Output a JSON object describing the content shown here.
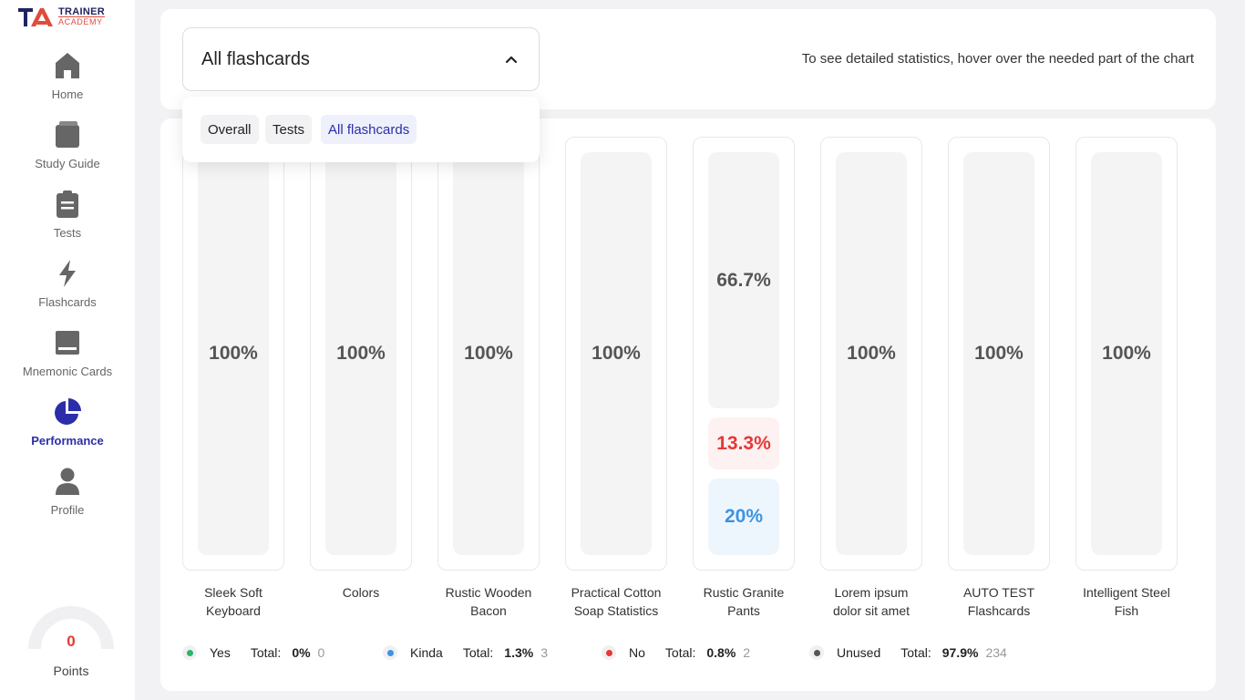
{
  "brand": {
    "line1": "TRAINER",
    "line2": "ACADEMY",
    "mark_color": "#e04b3b",
    "text_color": "#1f2460"
  },
  "nav": [
    {
      "label": "Home",
      "icon": "home-icon",
      "active": false
    },
    {
      "label": "Study Guide",
      "icon": "book-icon",
      "active": false
    },
    {
      "label": "Tests",
      "icon": "clipboard-icon",
      "active": false
    },
    {
      "label": "Flashcards",
      "icon": "lightning-icon",
      "active": false
    },
    {
      "label": "Mnemonic Cards",
      "icon": "card-icon",
      "active": false
    },
    {
      "label": "Performance",
      "icon": "pie-chart-icon",
      "active": true
    },
    {
      "label": "Profile",
      "icon": "user-icon",
      "active": false
    }
  ],
  "points": {
    "value": "0",
    "label": "Points"
  },
  "filter": {
    "selected": "All flashcards",
    "options": [
      "Overall",
      "Tests",
      "All flashcards"
    ],
    "hint": "To see detailed statistics, hover over the needed part of the chart"
  },
  "chart_data": {
    "type": "bar",
    "stacked": true,
    "categories": [
      "Sleek Soft Keyboard",
      "Colors",
      "Rustic Wooden Bacon",
      "Practical Cotton Soap Statistics",
      "Rustic Granite Pants",
      "Lorem ipsum dolor sit amet",
      "AUTO TEST Flashcards",
      "Intelligent Steel Fish"
    ],
    "category_lines": [
      [
        "Sleek Soft",
        "Keyboard"
      ],
      [
        "Colors",
        ""
      ],
      [
        "Rustic Wooden",
        "Bacon"
      ],
      [
        "Practical Cotton",
        "Soap Statistics"
      ],
      [
        "Rustic Granite",
        "Pants"
      ],
      [
        "Lorem ipsum",
        "dolor sit amet"
      ],
      [
        "AUTO TEST",
        "Flashcards"
      ],
      [
        "Intelligent Steel",
        "Fish"
      ]
    ],
    "series": [
      {
        "name": "Yes",
        "color": "#2db56a",
        "values": [
          0,
          0,
          0,
          0,
          0,
          0,
          0,
          0
        ]
      },
      {
        "name": "Kinda",
        "color": "#3d93e0",
        "values": [
          0,
          0,
          0,
          0,
          20,
          0,
          0,
          0
        ]
      },
      {
        "name": "No",
        "color": "#e53935",
        "values": [
          0,
          0,
          0,
          0,
          13.3,
          0,
          0,
          0
        ]
      },
      {
        "name": "Unused",
        "color": "#555555",
        "values": [
          100,
          100,
          100,
          100,
          66.7,
          100,
          100,
          100
        ]
      }
    ],
    "labels": {
      "unused": [
        "100%",
        "100%",
        "100%",
        "100%",
        "66.7%",
        "100%",
        "100%",
        "100%"
      ],
      "no": [
        "",
        "",
        "",
        "",
        "13.3%",
        "",
        "",
        ""
      ],
      "kinda": [
        "",
        "",
        "",
        "",
        "20%",
        "",
        "",
        ""
      ]
    },
    "unit": "%"
  },
  "legend": [
    {
      "name": "Yes",
      "color": "#2db56a",
      "total_label": "Total:",
      "pct": "0%",
      "count": "0"
    },
    {
      "name": "Kinda",
      "color": "#3d93e0",
      "total_label": "Total:",
      "pct": "1.3%",
      "count": "3"
    },
    {
      "name": "No",
      "color": "#e53935",
      "total_label": "Total:",
      "pct": "0.8%",
      "count": "2"
    },
    {
      "name": "Unused",
      "color": "#555555",
      "total_label": "Total:",
      "pct": "97.9%",
      "count": "234"
    }
  ]
}
